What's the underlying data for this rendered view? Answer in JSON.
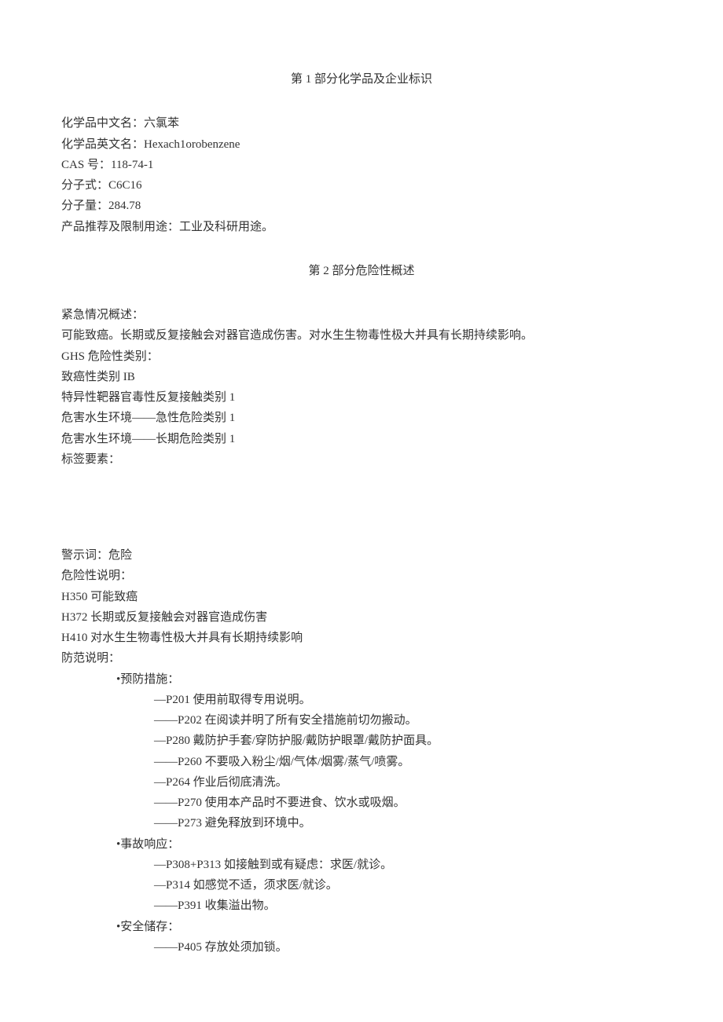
{
  "sections": {
    "s1_title": "第 1 部分化学品及企业标识",
    "s2_title": "第 2 部分危险性概述"
  },
  "ident": {
    "name_cn_label": "化学品中文名：",
    "name_cn": "六氯苯",
    "name_en_label": "化学品英文名：",
    "name_en": "Hexach1orobenzene",
    "cas_label": "CAS 号：",
    "cas": "118-74-1",
    "formula_label": "分子式：",
    "formula": "C6C16",
    "mw_label": "分子量：",
    "mw": "284.78",
    "use_label": "产品推荐及限制用途：",
    "use": "工业及科研用途。"
  },
  "hazard": {
    "emergency_label": "紧急情况概述：",
    "emergency_text": "可能致癌。长期或反复接触会对器官造成伤害。对水生生物毒性极大并具有长期持续影响。",
    "ghs_label": "GHS 危险性类别：",
    "ghs_items": [
      "致癌性类别 IB",
      "特异性靶器官毒性反复接触类别 1",
      "危害水生环境——急性危险类别 1",
      "危害水生环境——长期危险类别 1"
    ],
    "label_elements": "标签要素：",
    "signal_label": "警示词：",
    "signal": "危险",
    "hstatement_label": "危险性说明：",
    "hstatements": [
      "H350 可能致癌",
      "H372 长期或反复接触会对器官造成伤害",
      "H410 对水生生物毒性极大并具有长期持续影响"
    ],
    "precaution_label": "防范说明：",
    "groups": [
      {
        "title": "•预防措施：",
        "items": [
          "—P201 使用前取得专用说明。",
          "——P202 在阅读并明了所有安全措施前切勿搬动。",
          "—P280 戴防护手套/穿防护服/戴防护眼罩/戴防护面具。",
          "——P260 不要吸入粉尘/烟/气体/烟雾/蒸气/喷雾。",
          "—P264 作业后彻底清洗。",
          "——P270 使用本产品时不要进食、饮水或吸烟。",
          "——P273 避免释放到环境中。"
        ]
      },
      {
        "title": "•事故响应：",
        "items": [
          "—P308+P313 如接触到或有疑虑：求医/就诊。",
          "—P314 如感觉不适，须求医/就诊。",
          "——P391 收集溢出物。"
        ]
      },
      {
        "title": "•安全储存：",
        "items": [
          "——P405 存放处须加锁。"
        ]
      }
    ]
  }
}
